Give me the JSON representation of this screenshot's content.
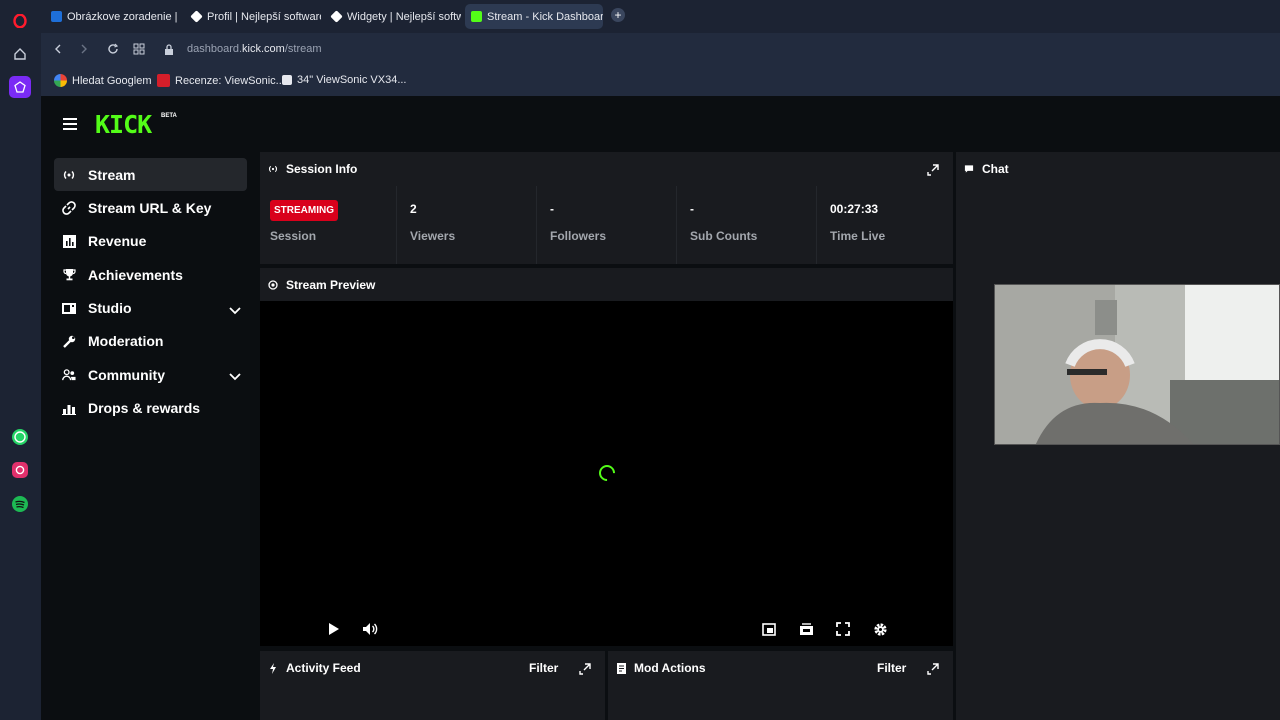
{
  "browser": {
    "tabs": [
      {
        "title": "Obrázkove zoradenie | bo",
        "active": false
      },
      {
        "title": "Profil | Nejlepší software p",
        "active": false
      },
      {
        "title": "Widgety | Nejlepší softwar",
        "active": false
      },
      {
        "title": "Stream - Kick Dashboard",
        "active": true
      }
    ],
    "url_prefix": "dashboard.",
    "url_domain": "kick.com",
    "url_path": "/stream",
    "bookmarks": [
      {
        "label": "Hledat Googlem"
      },
      {
        "label": "Recenze: ViewSonic..."
      },
      {
        "label": "34\" ViewSonic VX34..."
      }
    ]
  },
  "kick": {
    "logo": "KICK",
    "logo_badge": "BETA",
    "accent": "#53fc18",
    "nav": [
      {
        "label": "Stream",
        "icon": "stream-icon",
        "active": true
      },
      {
        "label": "Stream URL & Key",
        "icon": "link-icon"
      },
      {
        "label": "Revenue",
        "icon": "chart-icon"
      },
      {
        "label": "Achievements",
        "icon": "trophy-icon"
      },
      {
        "label": "Studio",
        "icon": "studio-icon",
        "expandable": true
      },
      {
        "label": "Moderation",
        "icon": "wrench-icon"
      },
      {
        "label": "Community",
        "icon": "users-icon",
        "expandable": true
      },
      {
        "label": "Drops & rewards",
        "icon": "drops-icon"
      }
    ],
    "session_info": {
      "title": "Session Info",
      "status_badge": "STREAMING",
      "status_label": "Session",
      "stats": [
        {
          "value": "2",
          "label": "Viewers"
        },
        {
          "value": "-",
          "label": "Followers"
        },
        {
          "value": "-",
          "label": "Sub Counts"
        },
        {
          "value": "00:27:33",
          "label": "Time Live"
        }
      ]
    },
    "stream_preview": {
      "title": "Stream Preview"
    },
    "activity_feed": {
      "title": "Activity Feed",
      "filter_label": "Filter"
    },
    "mod_actions": {
      "title": "Mod Actions",
      "filter_label": "Filter"
    },
    "chat": {
      "title": "Chat"
    }
  }
}
